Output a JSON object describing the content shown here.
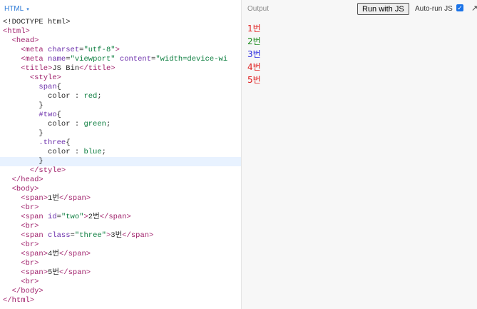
{
  "editor": {
    "label": "HTML",
    "caret": "▾",
    "lines": [
      [
        [
          "t",
          "<!DOCTYPE html>"
        ]
      ],
      [
        [
          "tag",
          "<html>"
        ]
      ],
      [
        [
          "s",
          "  "
        ],
        [
          "tag",
          "<head>"
        ]
      ],
      [
        [
          "s",
          "    "
        ],
        [
          "tag",
          "<meta "
        ],
        [
          "attr",
          "charset"
        ],
        [
          "s",
          "="
        ],
        [
          "val",
          "\"utf-8\""
        ],
        [
          "tag",
          ">"
        ]
      ],
      [
        [
          "s",
          "    "
        ],
        [
          "tag",
          "<meta "
        ],
        [
          "attr",
          "name"
        ],
        [
          "s",
          "="
        ],
        [
          "val",
          "\"viewport\""
        ],
        [
          "s",
          " "
        ],
        [
          "attr",
          "content"
        ],
        [
          "s",
          "="
        ],
        [
          "val",
          "\"width=device-wi"
        ]
      ],
      [
        [
          "s",
          "    "
        ],
        [
          "tag",
          "<title>"
        ],
        [
          "t",
          "JS Bin"
        ],
        [
          "tag",
          "</title>"
        ]
      ],
      [
        [
          "s",
          "      "
        ],
        [
          "tag",
          "<style>"
        ]
      ],
      [
        [
          "s",
          "        "
        ],
        [
          "sel",
          "span"
        ],
        [
          "t",
          "{"
        ]
      ],
      [
        [
          "s",
          "          "
        ],
        [
          "prop",
          "color"
        ],
        [
          "t",
          " : "
        ],
        [
          "val",
          "red"
        ],
        [
          "t",
          ";"
        ]
      ],
      [
        [
          "s",
          "        "
        ],
        [
          "t",
          "}"
        ]
      ],
      [
        [
          "s",
          "        "
        ],
        [
          "sel",
          "#two"
        ],
        [
          "t",
          "{"
        ]
      ],
      [
        [
          "s",
          "          "
        ],
        [
          "prop",
          "color"
        ],
        [
          "t",
          " : "
        ],
        [
          "val",
          "green"
        ],
        [
          "t",
          ";"
        ]
      ],
      [
        [
          "s",
          "        "
        ],
        [
          "t",
          "}"
        ]
      ],
      [
        [
          "s",
          "        "
        ],
        [
          "sel",
          ".three"
        ],
        [
          "t",
          "{"
        ]
      ],
      [
        [
          "s",
          "          "
        ],
        [
          "prop",
          "color"
        ],
        [
          "t",
          " : "
        ],
        [
          "val",
          "blue"
        ],
        [
          "t",
          ";"
        ]
      ],
      [
        [
          "s",
          "        "
        ],
        [
          "t",
          "}"
        ]
      ],
      [
        [
          "s",
          "      "
        ],
        [
          "tag",
          "</style>"
        ]
      ],
      [
        [
          "s",
          "  "
        ],
        [
          "tag",
          "</head>"
        ]
      ],
      [
        [
          "s",
          "  "
        ],
        [
          "tag",
          "<body>"
        ]
      ],
      [
        [
          "s",
          "    "
        ],
        [
          "tag",
          "<span>"
        ],
        [
          "t",
          "1번"
        ],
        [
          "tag",
          "</span>"
        ]
      ],
      [
        [
          "s",
          "    "
        ],
        [
          "tag",
          "<br>"
        ]
      ],
      [
        [
          "s",
          "    "
        ],
        [
          "tag",
          "<span "
        ],
        [
          "attr",
          "id"
        ],
        [
          "s",
          "="
        ],
        [
          "val",
          "\"two\""
        ],
        [
          "tag",
          ">"
        ],
        [
          "t",
          "2번"
        ],
        [
          "tag",
          "</span>"
        ]
      ],
      [
        [
          "s",
          "    "
        ],
        [
          "tag",
          "<br>"
        ]
      ],
      [
        [
          "s",
          "    "
        ],
        [
          "tag",
          "<span "
        ],
        [
          "attr",
          "class"
        ],
        [
          "s",
          "="
        ],
        [
          "val",
          "\"three\""
        ],
        [
          "tag",
          ">"
        ],
        [
          "t",
          "3번"
        ],
        [
          "tag",
          "</span>"
        ]
      ],
      [
        [
          "s",
          "    "
        ],
        [
          "tag",
          "<br>"
        ]
      ],
      [
        [
          "s",
          "    "
        ],
        [
          "tag",
          "<span>"
        ],
        [
          "t",
          "4번"
        ],
        [
          "tag",
          "</span>"
        ]
      ],
      [
        [
          "s",
          "    "
        ],
        [
          "tag",
          "<br>"
        ]
      ],
      [
        [
          "s",
          "    "
        ],
        [
          "tag",
          "<span>"
        ],
        [
          "t",
          "5번"
        ],
        [
          "tag",
          "</span>"
        ]
      ],
      [
        [
          "s",
          "    "
        ],
        [
          "tag",
          "<br>"
        ]
      ],
      [
        [
          "s",
          "  "
        ],
        [
          "tag",
          "</body>"
        ]
      ],
      [
        [
          "tag",
          "</html>"
        ]
      ]
    ],
    "active_line": 15
  },
  "output": {
    "title": "Output",
    "run_button": "Run with JS",
    "autorun_label": "Auto-run JS",
    "autorun_checked": "✓",
    "expand_icon": "↗",
    "results": [
      {
        "text": "1번",
        "color": "#e02020"
      },
      {
        "text": "2번",
        "color": "#1a8a1a"
      },
      {
        "text": "3번",
        "color": "#2a2ae0"
      },
      {
        "text": "4번",
        "color": "#e02020"
      },
      {
        "text": "5번",
        "color": "#e02020"
      }
    ]
  }
}
